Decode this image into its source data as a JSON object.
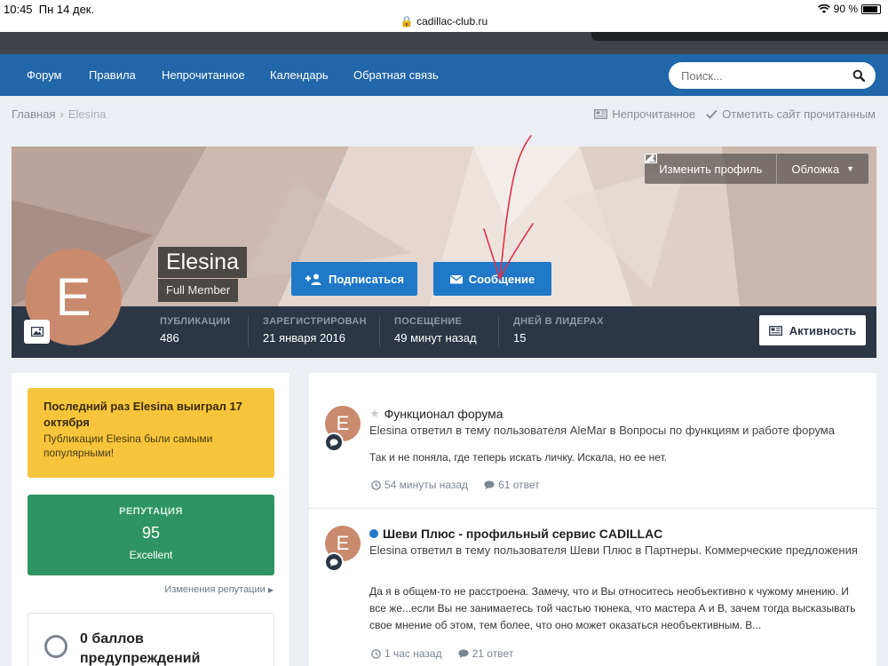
{
  "status_bar": {
    "time": "10:45",
    "date": "Пн 14 дек.",
    "url": "cadillac-club.ru",
    "battery": "90 %"
  },
  "nav": {
    "items": [
      "Форум",
      "Правила",
      "Непрочитанное",
      "Календарь",
      "Обратная связь"
    ],
    "search_placeholder": "Поиск..."
  },
  "breadcrumb": {
    "home": "Главная",
    "current": "Elesina"
  },
  "page_tools": {
    "unread": "Непрочитанное",
    "mark_read": "Отметить сайт прочитанным"
  },
  "profile": {
    "initial": "E",
    "name": "Elesina",
    "group": "Full Member",
    "edit_profile": "Изменить профиль",
    "cover": "Обложка",
    "follow": "Подписаться",
    "message": "Сообщение",
    "activity": "Активность",
    "stats": [
      {
        "label": "ПУБЛИКАЦИИ",
        "value": "486"
      },
      {
        "label": "ЗАРЕГИСТРИРОВАН",
        "value": "21 января 2016"
      },
      {
        "label": "ПОСЕЩЕНИЕ",
        "value": "49 минут назад"
      },
      {
        "label": "ДНЕЙ В ЛИДЕРАХ",
        "value": "15"
      }
    ]
  },
  "sidebar": {
    "leader_title": "Последний раз Elesina выиграл 17 октября",
    "leader_text": "Публикации Elesina были самыми популярными!",
    "reputation_label": "РЕПУТАЦИЯ",
    "reputation_value": "95",
    "reputation_level": "Excellent",
    "reputation_link": "Изменения репутации",
    "warnings": "0 баллов предупреждений"
  },
  "feed": [
    {
      "title": "Функционал форума",
      "subtitle": "Elesina ответил в тему пользователя AleMar в Вопросы по функциям и работе форума",
      "text": "Так и не поняла, где теперь искать личку. Искала, но ее нет.",
      "time": "54 минуты назад",
      "replies": "61 ответ"
    },
    {
      "title": "Шеви Плюс - профильный сервис CADILLAC",
      "subtitle": "Elesina ответил в тему пользователя Шеви Плюс в Партнеры. Коммерческие предложения",
      "text": "Да я в общем-то не расстроена. Замечу, что и Вы относитесь необъективно к чужому мнению. И все же...если Вы не занимаетесь той частью тюнека, что мастера А и В, зачем тогда высказывать свое мнение об этом, тем более, что оно может оказаться необъективным. В...",
      "time": "1 час назад",
      "replies": "21 ответ"
    }
  ],
  "colors": {
    "nav": "#2066a9",
    "primary_button": "#1f78c8",
    "stats_bar": "#2c3645",
    "leader": "#f7c53c",
    "reputation": "#2f9463",
    "avatar": "#c98a6e",
    "annotation_arrow": "#e0304a"
  }
}
